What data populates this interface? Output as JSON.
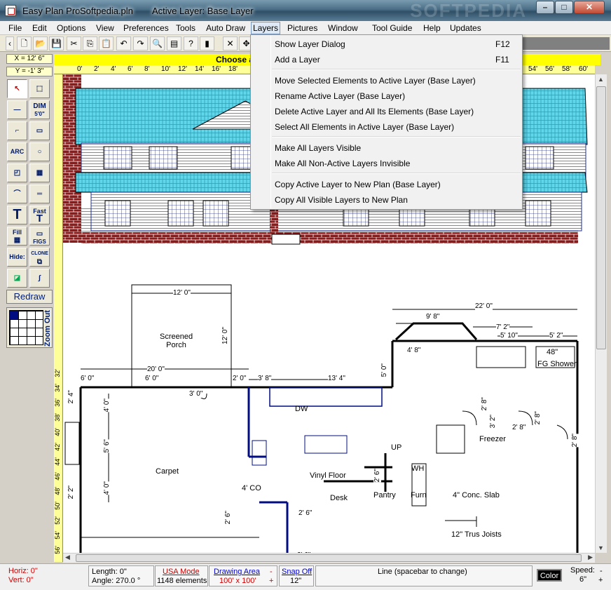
{
  "window": {
    "app_title": "Easy Plan Pro",
    "file_name": "Softpedia.pln",
    "active_layer": "Active Layer: Base Layer",
    "watermark": "SOFTPEDIA",
    "btn_minimize": "–",
    "btn_maximize": "□",
    "btn_close": "✕"
  },
  "menu": [
    "File",
    "Edit",
    "Options",
    "View",
    "Preferences",
    "Tools",
    "Auto Draw",
    "Layers",
    "Pictures",
    "Window",
    "Tool Guide",
    "Help",
    "Updates"
  ],
  "toolbar": {
    "buttons": [
      {
        "name": "back-arrow-icon",
        "glyph": "‹"
      },
      {
        "name": "new-file-icon",
        "glyph": "🗋"
      },
      {
        "name": "open-folder-icon",
        "glyph": "📂"
      },
      {
        "name": "save-icon",
        "glyph": "💾"
      },
      {
        "name": "cut-icon",
        "glyph": "✂"
      },
      {
        "name": "copy-icon",
        "glyph": "⎘"
      },
      {
        "name": "paste-icon",
        "glyph": "📋"
      },
      {
        "name": "undo-icon",
        "glyph": "↶"
      },
      {
        "name": "redo-icon",
        "glyph": "↷"
      },
      {
        "name": "zoom-icon",
        "glyph": "🔍"
      },
      {
        "name": "print-preview-icon",
        "glyph": "▤"
      },
      {
        "name": "help-icon",
        "glyph": "?"
      },
      {
        "name": "exit-door-icon",
        "glyph": "▮"
      },
      {
        "name": "delete-x-icon",
        "glyph": "✕"
      },
      {
        "name": "move-icon",
        "glyph": "✥"
      }
    ]
  },
  "coords": {
    "x": "X = 12' 6\"",
    "y": "Y = -1' 3\""
  },
  "prompt": "Choose a",
  "ruler": {
    "h_left": [
      "0'",
      "2'",
      "4'",
      "6'",
      "8'",
      "10'",
      "12'",
      "14'",
      "16'",
      "18'"
    ],
    "h_right": [
      "54'",
      "56'",
      "58'",
      "60'",
      "62'"
    ],
    "v": [
      "32'",
      "34'",
      "36'",
      "38'",
      "40'",
      "42'",
      "44'",
      "46'",
      "48'",
      "50'",
      "52'",
      "54'",
      "56'"
    ]
  },
  "palette": {
    "dim_label": "DIM",
    "dim_sub": "5'0\"",
    "arc_label": "ARC",
    "text_big": "T",
    "fast_label": "Fast",
    "fill_label": "Fill",
    "figs_label": "FIGS",
    "hide_label": "Hide:",
    "clone_label": "CLONE",
    "redraw_label": "Redraw",
    "zoom_label": "Zoom Out"
  },
  "layers_menu": [
    {
      "label": "Show Layer Dialog",
      "shortcut": "F12"
    },
    {
      "label": "Add a Layer",
      "shortcut": "F11"
    },
    {
      "label": "Move Selected Elements to Active Layer  (Base Layer)",
      "shortcut": ""
    },
    {
      "label": "Rename Active Layer    (Base Layer)",
      "shortcut": ""
    },
    {
      "label": "Delete Active Layer and All Its Elements     (Base Layer)",
      "shortcut": ""
    },
    {
      "label": "Select All Elements in Active Layer     (Base Layer)",
      "shortcut": ""
    },
    {
      "label": "Make All Layers Visible",
      "shortcut": ""
    },
    {
      "label": "Make All Non-Active Layers Invisible",
      "shortcut": ""
    },
    {
      "label": "Copy Active Layer to New Plan     (Base Layer)",
      "shortcut": ""
    },
    {
      "label": "Copy All Visible Layers to New Plan",
      "shortcut": ""
    }
  ],
  "plan": {
    "dims": [
      "12' 0\"",
      "12' 0\"",
      "9' 8\"",
      "22' 0\"",
      "7' 2\"",
      "5' 10\"",
      "5' 2\"",
      "4' 8\"",
      "5' 0\"",
      "20' 0\"",
      "6' 0\"",
      "6' 0\"",
      "2' 0\"",
      "3' 8\"",
      "13' 4\"",
      "2' 4\"",
      "4' 0\"",
      "5' 6\"",
      "4' 0\"",
      "2' 2\"",
      "3' 0\"",
      "2' 8\"",
      "3' 2\"",
      "2' 8\"",
      "2' 8\"",
      "2' 8\"",
      "2' 6\"",
      "2' 6\"",
      "2' 6\"",
      "2' 6\""
    ],
    "rooms": [
      "Screened\nPorch",
      "Carpet",
      "4' CO",
      "Vinyl Floor",
      "DW",
      "UP",
      "WH",
      "Desk",
      "Pantry",
      "Furn",
      "4\" Conc. Slab",
      "12\" Trus Joists",
      "Freezer",
      "48\"",
      "FG Shower"
    ]
  },
  "status": {
    "horiz": "Horiz: 0\"",
    "vert": "Vert: 0\"",
    "length": "Length:  0\"",
    "angle": "Angle:  270.0 °",
    "mode_label": "USA Mode",
    "elements": "1148 elements",
    "area_label": "Drawing Area",
    "area_value": "100' x 100'",
    "minus": "-",
    "plus": "+",
    "snap_label": "Snap Off",
    "snap_value": "12\"",
    "line_hint": "Line  (spacebar to change)",
    "color_btn": "Color",
    "speed_label": "Speed:",
    "speed_value": "6\"",
    "speed_minus": "-",
    "speed_plus": "+"
  }
}
